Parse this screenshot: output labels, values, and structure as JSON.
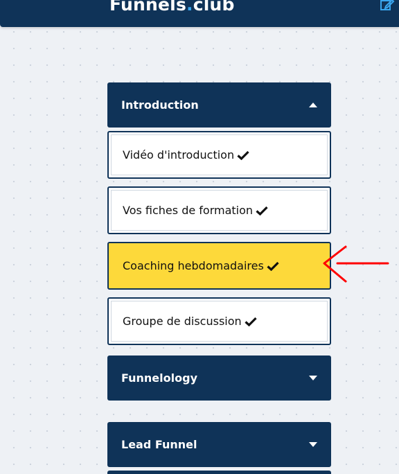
{
  "header": {
    "logo_main": "Funnels",
    "logo_dot": ".",
    "logo_tail": "club",
    "edit_icon": "edit-icon"
  },
  "sections": [
    {
      "label": "Introduction",
      "state": "expanded"
    },
    {
      "label": "Funnelology",
      "state": "collapsed"
    },
    {
      "label": "Lead Funnel",
      "state": "collapsed"
    }
  ],
  "lessons": [
    {
      "label": "Vidéo d'introduction",
      "completed": true
    },
    {
      "label": "Vos fiches de formation",
      "completed": true
    },
    {
      "label": "Coaching hebdomadaires",
      "completed": true,
      "highlighted": true
    },
    {
      "label": "Groupe de discussion",
      "completed": true
    }
  ],
  "colors": {
    "navy": "#0f3358",
    "highlight": "#fdd93a",
    "logo_dot": "#3aa6ef",
    "annotation_arrow": "#ff0000"
  }
}
